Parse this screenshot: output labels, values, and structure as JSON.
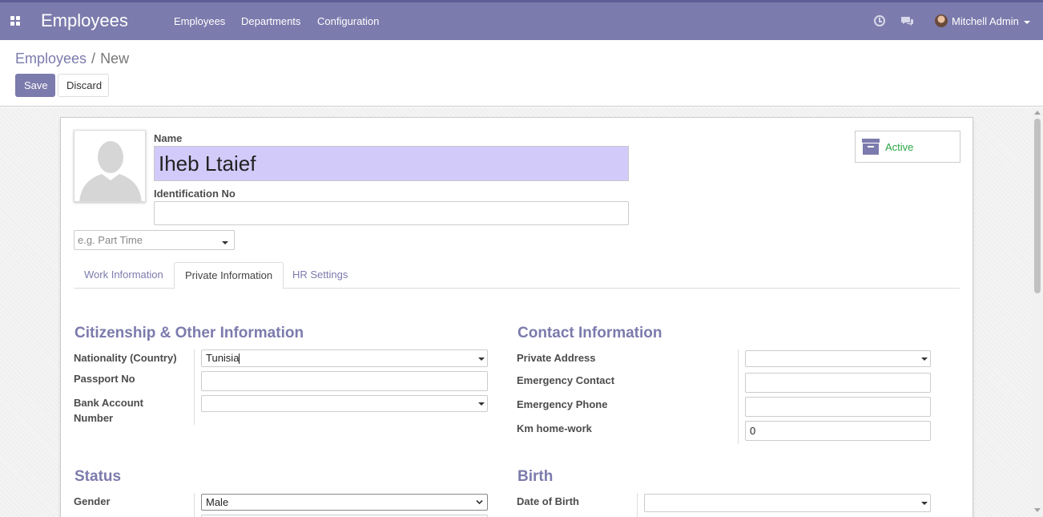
{
  "navbar": {
    "app_title": "Employees",
    "menu": [
      "Employees",
      "Departments",
      "Configuration"
    ],
    "user_name": "Mitchell Admin"
  },
  "breadcrumb": {
    "parent": "Employees",
    "separator": "/",
    "current": "New"
  },
  "buttons": {
    "save": "Save",
    "discard": "Discard"
  },
  "header": {
    "name_label": "Name",
    "name_value": "Iheb Ltaief",
    "ident_label": "Identification No",
    "ident_value": "",
    "category_placeholder": "e.g. Part Time",
    "active_label": "Active"
  },
  "tabs": [
    {
      "label": "Work Information",
      "active": false
    },
    {
      "label": "Private Information",
      "active": true
    },
    {
      "label": "HR Settings",
      "active": false
    }
  ],
  "citizenship": {
    "title": "Citizenship & Other Information",
    "nationality_label": "Nationality (Country)",
    "nationality_value": "Tunisia",
    "passport_label": "Passport No",
    "passport_value": "",
    "bank_label_1": "Bank Account",
    "bank_label_2": "Number",
    "bank_value": ""
  },
  "contact": {
    "title": "Contact Information",
    "private_address_label": "Private Address",
    "emergency_contact_label": "Emergency Contact",
    "emergency_phone_label": "Emergency Phone",
    "km_home_work_label": "Km home-work",
    "km_home_work_value": "0"
  },
  "status": {
    "title": "Status",
    "gender_label": "Gender",
    "gender_value": "Male"
  },
  "birth": {
    "title": "Birth",
    "date_of_birth_label": "Date of Birth",
    "date_of_birth_value": ""
  },
  "colors": {
    "brand": "#7c7bad",
    "name_highlight": "#d2cbfa",
    "active_green": "#28a745"
  }
}
